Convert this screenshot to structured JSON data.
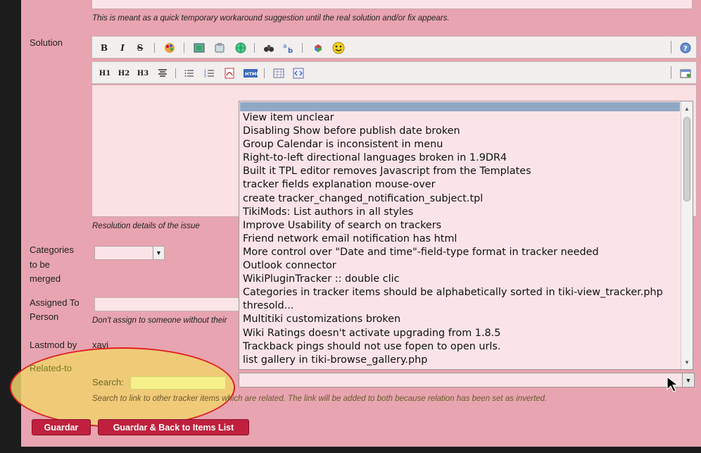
{
  "workaround_help": "This is meant as a quick temporary workaround suggestion until the real solution and/or fix appears.",
  "solution": {
    "label": "Solution",
    "help": "Resolution details of the issue",
    "toolbar1": [
      "B",
      "I",
      "S"
    ],
    "toolbar2": [
      "H1",
      "H2",
      "H3"
    ]
  },
  "categories": {
    "label_line1": "Categories",
    "label_line2": "to be",
    "label_line3": "merged"
  },
  "assigned": {
    "label_line1": "Assigned To",
    "label_line2": "Person",
    "help": "Don't assign to someone without their"
  },
  "lastmod": {
    "label": "Lastmod by",
    "value": "xavi"
  },
  "related": {
    "label": "Related-to",
    "search_label": "Search:",
    "search_value": "",
    "help": "Search to link to other tracker items which are related. The link will be added to both because relation has been set as inverted."
  },
  "related_options": [
    "View item unclear",
    "Disabling Show before publish date broken",
    "Group Calendar is inconsistent in menu",
    "Right-to-left directional languages broken in 1.9DR4",
    "Built it TPL editor removes Javascript from the Templates",
    "tracker fields explanation mouse-over",
    "create tracker_changed_notification_subject.tpl",
    "TikiMods: List authors in all styles",
    "Improve Usability of search on trackers",
    "Friend network email notification has html",
    "More control over \"Date and time\"-field-type format in tracker needed",
    "Outlook connector",
    "WikiPluginTracker :: double clic",
    "Categories in tracker items should be alphabetically sorted in tiki-view_tracker.php",
    "thresold...",
    "Multitiki customizations broken",
    "Wiki Ratings doesn't activate upgrading from 1.8.5",
    "Trackback pings should not use fopen to open urls.",
    "list gallery in tiki-browse_gallery.php"
  ],
  "buttons": {
    "save": "Guardar",
    "save_back": "Guardar & Back to Items List"
  }
}
